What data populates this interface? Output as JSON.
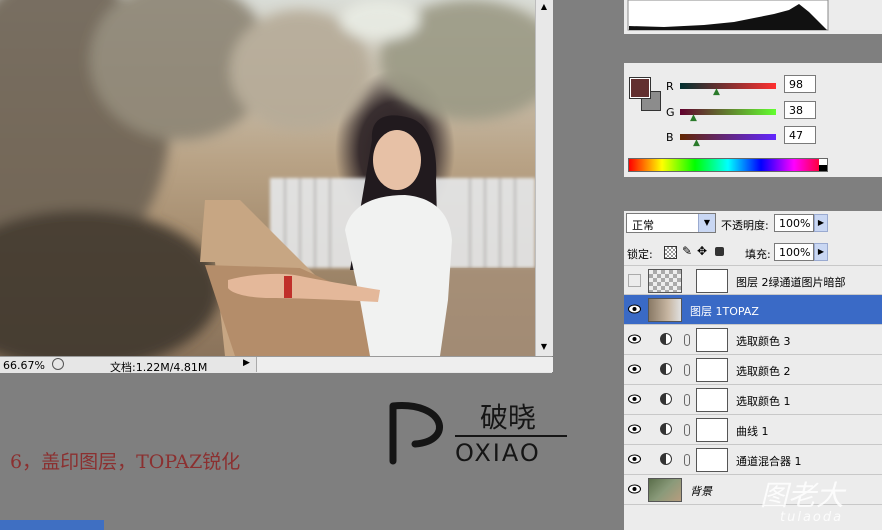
{
  "document": {
    "zoom": "66.67%",
    "doc_info": "文档:1.22M/4.81M"
  },
  "color_panel": {
    "foreground": "#622f2f",
    "background": "#8c8c8c",
    "channels": [
      {
        "label": "R",
        "value": "98"
      },
      {
        "label": "G",
        "value": "38"
      },
      {
        "label": "B",
        "value": "47"
      }
    ]
  },
  "layers_panel": {
    "blend_mode": "正常",
    "opacity_label": "不透明度:",
    "opacity_value": "100%",
    "lock_label": "锁定:",
    "fill_label": "填充:",
    "fill_value": "100%",
    "layers": [
      {
        "name": "图层 2绿通道图片暗部",
        "visible": false,
        "selected": false
      },
      {
        "name": "图层 1TOPAZ",
        "visible": true,
        "selected": true
      },
      {
        "name": "选取颜色 3",
        "visible": true,
        "selected": false
      },
      {
        "name": "选取颜色 2",
        "visible": true,
        "selected": false
      },
      {
        "name": "选取颜色 1",
        "visible": true,
        "selected": false
      },
      {
        "name": "曲线 1",
        "visible": true,
        "selected": false
      },
      {
        "name": "通道混合器 1",
        "visible": true,
        "selected": false
      },
      {
        "name": "背景",
        "visible": true,
        "selected": false
      }
    ]
  },
  "caption": "6，盖印图层，TOPAZ锐化",
  "logo": {
    "cn": "破晓",
    "en": "OXIAO"
  },
  "watermark": {
    "cn": "图老大",
    "en": "tulaoda"
  },
  "colors": {
    "selected_row": "#3a6ac6",
    "caption": "#8b3030"
  }
}
